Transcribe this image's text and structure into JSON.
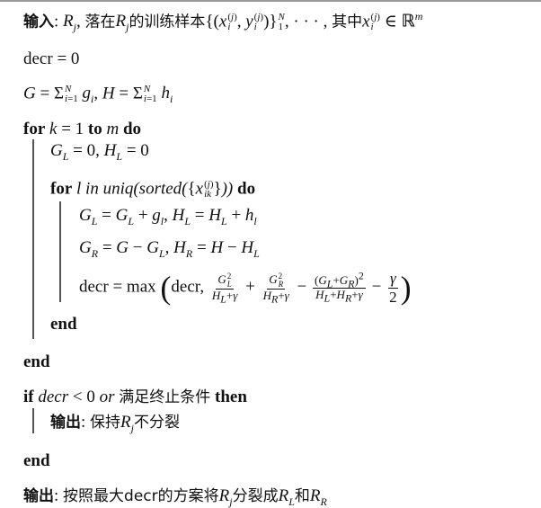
{
  "algorithm": {
    "input_label": "输入",
    "input_text_1": "落在",
    "input_text_2": "的训练样本",
    "input_text_3": "其中",
    "init_decr": "decr = 0",
    "kw_for": "for",
    "kw_to": "to",
    "kw_do": "do",
    "kw_end": "end",
    "kw_if": "if",
    "kw_then": "then",
    "kw_in": "in",
    "kw_or": "or",
    "uniq_sorted": "uniq(sorted(",
    "condition_cn": "满足终止条件",
    "output_label": "输出",
    "output_keep": "保持",
    "output_keep_2": "不分裂",
    "final_output_1": "按照最大decr的方案将",
    "final_output_2": "分裂成",
    "final_output_3": "和",
    "decr_word": "decr",
    "max_word": "max",
    "gamma": "γ",
    "two": "2"
  }
}
